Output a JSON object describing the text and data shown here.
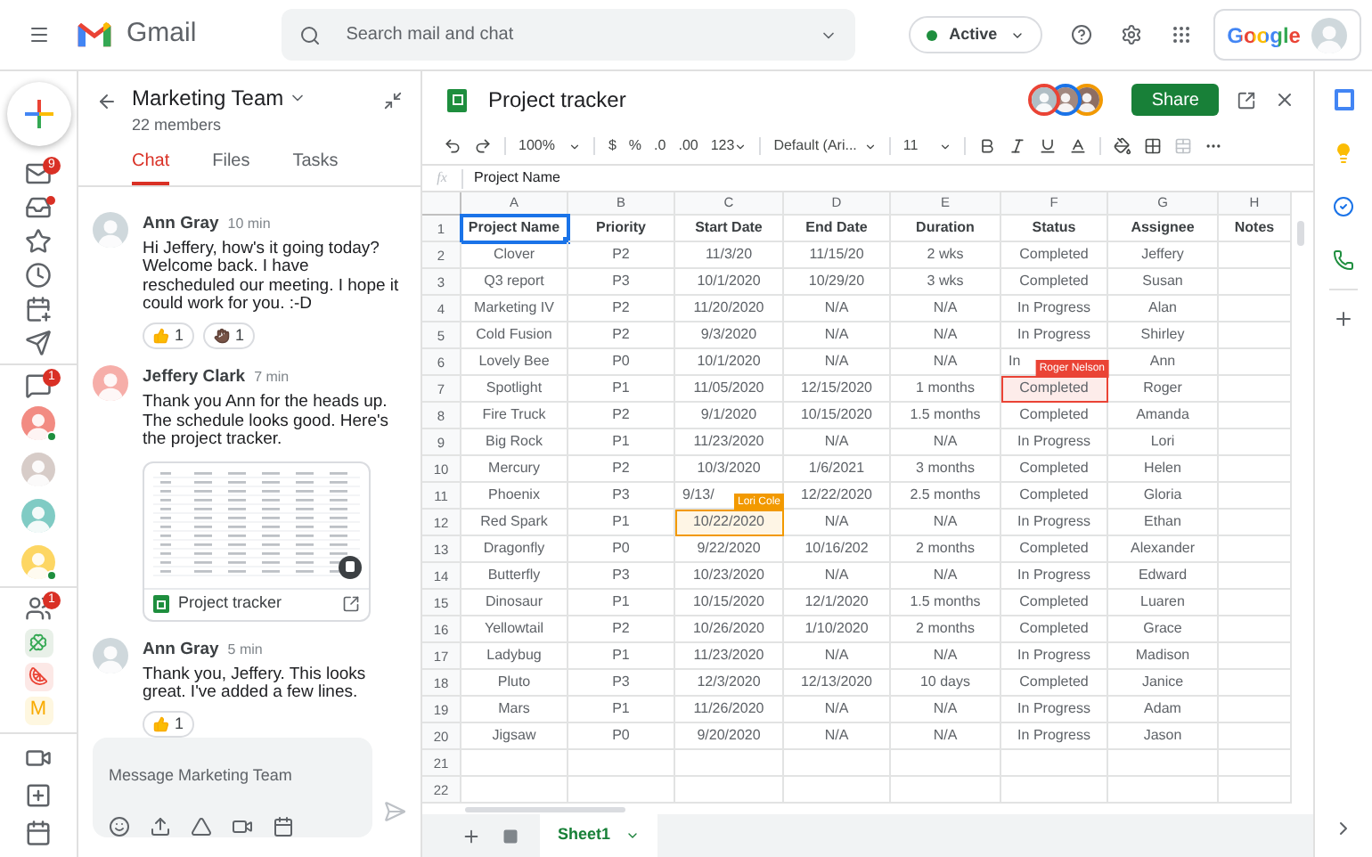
{
  "topbar": {
    "app_name": "Gmail",
    "search": {
      "placeholder": "Search mail and chat"
    },
    "status": {
      "label": "Active",
      "active": true
    },
    "account_logo": "Google"
  },
  "rail": {
    "mail_items": [
      {
        "kind": "mail",
        "badge": "9"
      },
      {
        "kind": "inbox",
        "dot": true
      },
      {
        "kind": "star"
      },
      {
        "kind": "clock"
      },
      {
        "kind": "scheduled"
      },
      {
        "kind": "sent"
      }
    ],
    "chat_items": [
      {
        "kind": "chat",
        "badge": "1"
      }
    ],
    "people": [
      {
        "online": true,
        "color": "#f28b82"
      },
      {
        "online": false,
        "color": "#d7ccc8"
      },
      {
        "online": false,
        "color": "#80cbc4"
      },
      {
        "online": true,
        "color": "#fdd663"
      }
    ],
    "rooms": [
      {
        "kind": "group",
        "badge": "1"
      },
      {
        "kind": "clover"
      },
      {
        "kind": "melon"
      },
      {
        "kind": "letter",
        "letter": "M"
      }
    ],
    "meet_items": [
      {
        "kind": "video"
      },
      {
        "kind": "new-meeting"
      },
      {
        "kind": "calendar"
      }
    ]
  },
  "chat": {
    "title": "Marketing Team",
    "subtitle": "22 members",
    "tabs": [
      {
        "label": "Chat",
        "selected": true
      },
      {
        "label": "Files",
        "selected": false
      },
      {
        "label": "Tasks",
        "selected": false
      }
    ],
    "messages": [
      {
        "author": "Ann Gray",
        "time": "10 min",
        "text": "Hi Jeffery, how's it going today? Welcome back. I have rescheduled our meeting. I hope it could work for you. :-D",
        "reactions": [
          {
            "kind": "thumbs-up",
            "count": "1"
          },
          {
            "kind": "fist",
            "count": "1"
          }
        ]
      },
      {
        "author": "Jeffery Clark",
        "time": "7 min",
        "text": "Thank you Ann for the heads up. The schedule looks good. Here's the project tracker.",
        "attachment": {
          "title": "Project tracker"
        }
      },
      {
        "author": "Ann Gray",
        "time": "5 min",
        "text": "Thank you, Jeffery. This looks great. I've added a few lines.",
        "reactions": [
          {
            "kind": "thumbs-up",
            "count": "1"
          }
        ]
      }
    ],
    "composer": {
      "placeholder": "Message Marketing Team"
    }
  },
  "sheet": {
    "title": "Project tracker",
    "share_label": "Share",
    "toolbar": {
      "zoom": "100%",
      "currency": "$",
      "percent": "%",
      "decimals_less": ".0",
      "decimals_more": ".00",
      "format": "123",
      "font": "Default (Ari...",
      "font_size": "11"
    },
    "formula": {
      "label": "fx",
      "value": "Project Name"
    },
    "columns": [
      "A",
      "B",
      "C",
      "D",
      "E",
      "F",
      "G",
      "H"
    ],
    "rows": [
      {
        "number": "1",
        "header": true,
        "cells": [
          {
            "text": "Project Name",
            "selected": true
          },
          "Priority",
          "Start Date",
          "End Date",
          "Duration",
          "Status",
          "Assignee",
          "Notes"
        ]
      },
      {
        "number": "2",
        "cells": [
          "Clover",
          "P2",
          "11/3/20",
          "11/15/20",
          "2 wks",
          "Completed",
          "Jeffery"
        ]
      },
      {
        "number": "3",
        "cells": [
          "Q3 report",
          "P3",
          "10/1/2020",
          "10/29/20",
          "3 wks",
          "Completed",
          "Susan"
        ]
      },
      {
        "number": "4",
        "cells": [
          "Marketing IV",
          "P2",
          "11/20/2020",
          "N/A",
          "N/A",
          "In Progress",
          "Alan"
        ]
      },
      {
        "number": "5",
        "cells": [
          "Cold Fusion",
          "P2",
          "9/3/2020",
          "N/A",
          "N/A",
          "In Progress",
          "Shirley"
        ]
      },
      {
        "number": "6",
        "cells": [
          "Lovely Bee",
          "P0",
          "10/1/2020",
          "N/A",
          "N/A",
          {
            "text": "In",
            "cut": true
          },
          "Ann"
        ]
      },
      {
        "number": "7",
        "cells": [
          "Spotlight",
          "P1",
          "11/05/2020",
          "12/15/2020",
          "1 months",
          {
            "text": "Completed",
            "cursor": {
              "label": "Roger Nelson",
              "color": "#ea4335"
            }
          },
          "Roger"
        ]
      },
      {
        "number": "8",
        "cells": [
          "Fire Truck",
          "P2",
          "9/1/2020",
          "10/15/2020",
          "1.5 months",
          "Completed",
          "Amanda"
        ]
      },
      {
        "number": "9",
        "cells": [
          "Big Rock",
          "P1",
          "11/23/2020",
          "N/A",
          "N/A",
          "In Progress",
          "Lori"
        ]
      },
      {
        "number": "10",
        "cells": [
          "Mercury",
          "P2",
          "10/3/2020",
          "1/6/2021",
          "3 months",
          "Completed",
          "Helen"
        ]
      },
      {
        "number": "11",
        "cells": [
          "Phoenix",
          "P3",
          {
            "text": "9/13/",
            "cut": true
          },
          "12/22/2020",
          "2.5 months",
          "Completed",
          "Gloria"
        ]
      },
      {
        "number": "12",
        "cells": [
          "Red Spark",
          "P1",
          {
            "text": "10/22/2020",
            "cursor": {
              "label": "Lori Cole",
              "color": "#f29900"
            }
          },
          "N/A",
          "N/A",
          "In Progress",
          "Ethan"
        ]
      },
      {
        "number": "13",
        "cells": [
          "Dragonfly",
          "P0",
          "9/22/2020",
          "10/16/202",
          "2 months",
          "Completed",
          "Alexander"
        ]
      },
      {
        "number": "14",
        "cells": [
          "Butterfly",
          "P3",
          "10/23/2020",
          "N/A",
          "N/A",
          "In Progress",
          "Edward"
        ]
      },
      {
        "number": "15",
        "cells": [
          "Dinosaur",
          "P1",
          "10/15/2020",
          "12/1/2020",
          "1.5 months",
          "Completed",
          "Luaren"
        ]
      },
      {
        "number": "16",
        "cells": [
          "Yellowtail",
          "P2",
          "10/26/2020",
          "1/10/2020",
          "2 months",
          "Completed",
          "Grace"
        ]
      },
      {
        "number": "17",
        "cells": [
          "Ladybug",
          "P1",
          "11/23/2020",
          "N/A",
          "N/A",
          "In Progress",
          "Madison"
        ]
      },
      {
        "number": "18",
        "cells": [
          "Pluto",
          "P3",
          "12/3/2020",
          "12/13/2020",
          "10 days",
          "Completed",
          "Janice"
        ]
      },
      {
        "number": "19",
        "cells": [
          "Mars",
          "P1",
          "11/26/2020",
          "N/A",
          "N/A",
          "In Progress",
          "Adam"
        ]
      },
      {
        "number": "20",
        "cells": [
          "Jigsaw",
          "P0",
          "9/20/2020",
          "N/A",
          "N/A",
          "In Progress",
          "Jason"
        ]
      },
      {
        "number": "21"
      },
      {
        "number": "22"
      }
    ],
    "sheet_tabs": [
      {
        "label": "Sheet1",
        "selected": true
      }
    ]
  }
}
